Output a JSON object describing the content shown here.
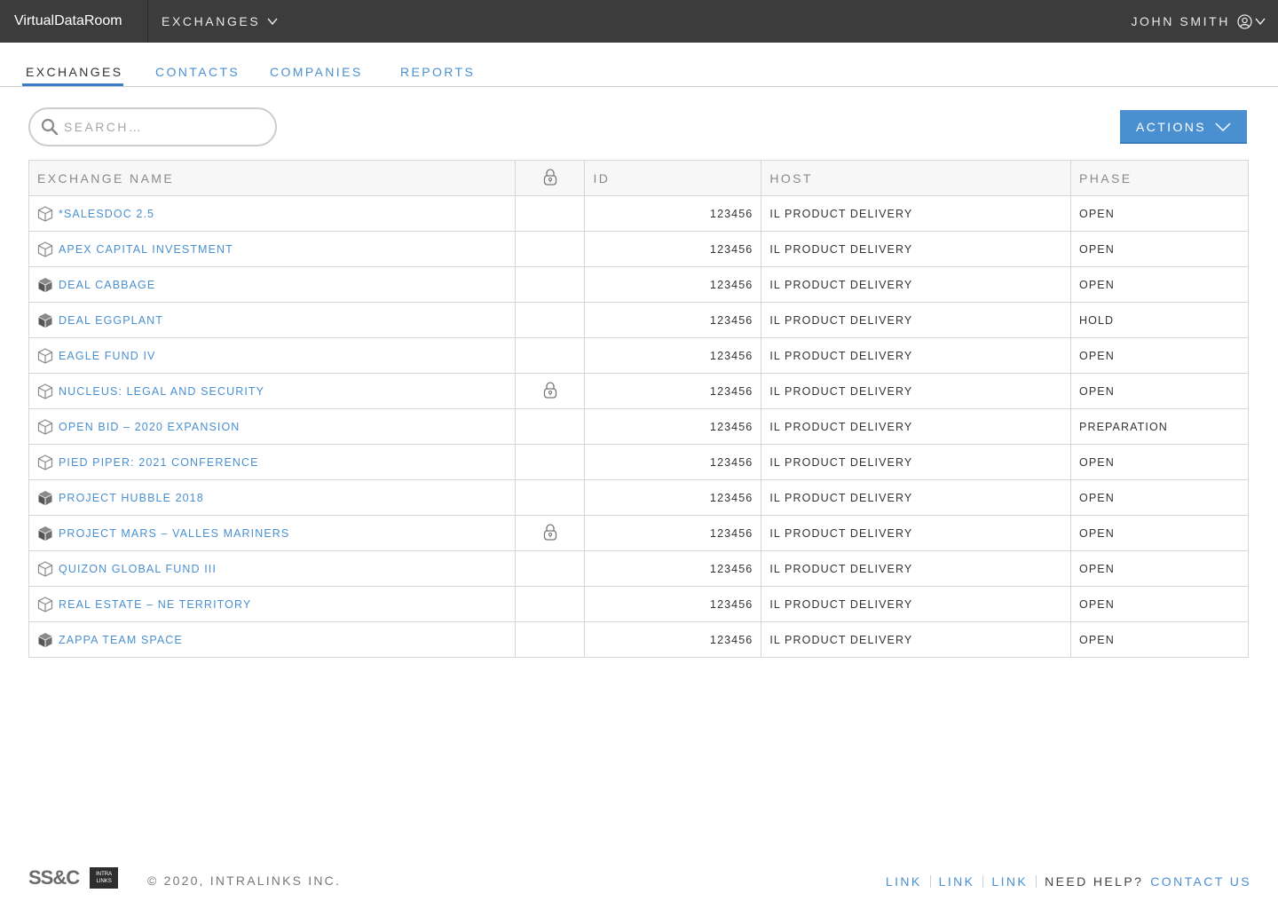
{
  "brand": "VirtualDataRoom",
  "top_nav": {
    "label": "EXCHANGES"
  },
  "user": {
    "name": "JOHN SMITH"
  },
  "tabs": [
    {
      "label": "EXCHANGES",
      "active": true
    },
    {
      "label": "CONTACTS",
      "active": false
    },
    {
      "label": "COMPANIES",
      "active": false
    },
    {
      "label": "REPORTS",
      "active": false
    }
  ],
  "search": {
    "placeholder": "SEARCH…",
    "value": ""
  },
  "actions_label": "ACTIONS",
  "table": {
    "headers": {
      "name": "EXCHANGE NAME",
      "id": "ID",
      "host": "HOST",
      "phase": "PHASE"
    },
    "rows": [
      {
        "name": "*SALESDOC 2.5",
        "icon": "box-outline-icon",
        "locked": false,
        "id": "123456",
        "host": "IL PRODUCT DELIVERY",
        "phase": "OPEN"
      },
      {
        "name": "APEX CAPITAL INVESTMENT",
        "icon": "box-outline-icon",
        "locked": false,
        "id": "123456",
        "host": "IL PRODUCT DELIVERY",
        "phase": "OPEN"
      },
      {
        "name": "DEAL CABBAGE",
        "icon": "box-filled-icon",
        "locked": false,
        "id": "123456",
        "host": "IL PRODUCT DELIVERY",
        "phase": "OPEN"
      },
      {
        "name": "DEAL EGGPLANT",
        "icon": "box-filled-icon",
        "locked": false,
        "id": "123456",
        "host": "IL PRODUCT DELIVERY",
        "phase": "HOLD"
      },
      {
        "name": "EAGLE FUND IV",
        "icon": "box-outline-icon",
        "locked": false,
        "id": "123456",
        "host": "IL PRODUCT DELIVERY",
        "phase": "OPEN"
      },
      {
        "name": "NUCLEUS: LEGAL AND SECURITY",
        "icon": "box-outline-icon",
        "locked": true,
        "id": "123456",
        "host": "IL PRODUCT DELIVERY",
        "phase": "OPEN"
      },
      {
        "name": "OPEN BID – 2020 EXPANSION",
        "icon": "box-outline-icon",
        "locked": false,
        "id": "123456",
        "host": "IL PRODUCT DELIVERY",
        "phase": "PREPARATION"
      },
      {
        "name": "PIED PIPER: 2021 CONFERENCE",
        "icon": "box-outline-icon",
        "locked": false,
        "id": "123456",
        "host": "IL PRODUCT DELIVERY",
        "phase": "OPEN"
      },
      {
        "name": "PROJECT HUBBLE 2018",
        "icon": "box-filled-icon",
        "locked": false,
        "id": "123456",
        "host": "IL PRODUCT DELIVERY",
        "phase": "OPEN"
      },
      {
        "name": "PROJECT MARS – VALLES MARINERS",
        "icon": "box-filled-icon",
        "locked": true,
        "id": "123456",
        "host": "IL PRODUCT DELIVERY",
        "phase": "OPEN"
      },
      {
        "name": "QUIZON GLOBAL FUND III",
        "icon": "box-outline-icon",
        "locked": false,
        "id": "123456",
        "host": "IL PRODUCT DELIVERY",
        "phase": "OPEN"
      },
      {
        "name": "REAL ESTATE – NE TERRITORY",
        "icon": "box-outline-icon",
        "locked": false,
        "id": "123456",
        "host": "IL PRODUCT DELIVERY",
        "phase": "OPEN"
      },
      {
        "name": "ZAPPA TEAM SPACE",
        "icon": "box-filled-icon",
        "locked": false,
        "id": "123456",
        "host": "IL PRODUCT DELIVERY",
        "phase": "OPEN"
      }
    ]
  },
  "footer": {
    "logo_text": "SS&C",
    "logo_box_lines": [
      "INTRA",
      "LINKS"
    ],
    "copyright": "© 2020, INTRALINKS INC.",
    "links": [
      "LINK",
      "LINK",
      "LINK"
    ],
    "help_text": "NEED HELP?",
    "contact_label": "CONTACT US"
  },
  "colors": {
    "topbar": "#3c3c3c",
    "accent": "#4a90d0",
    "active_tab_underline": "#3d7cc9"
  }
}
